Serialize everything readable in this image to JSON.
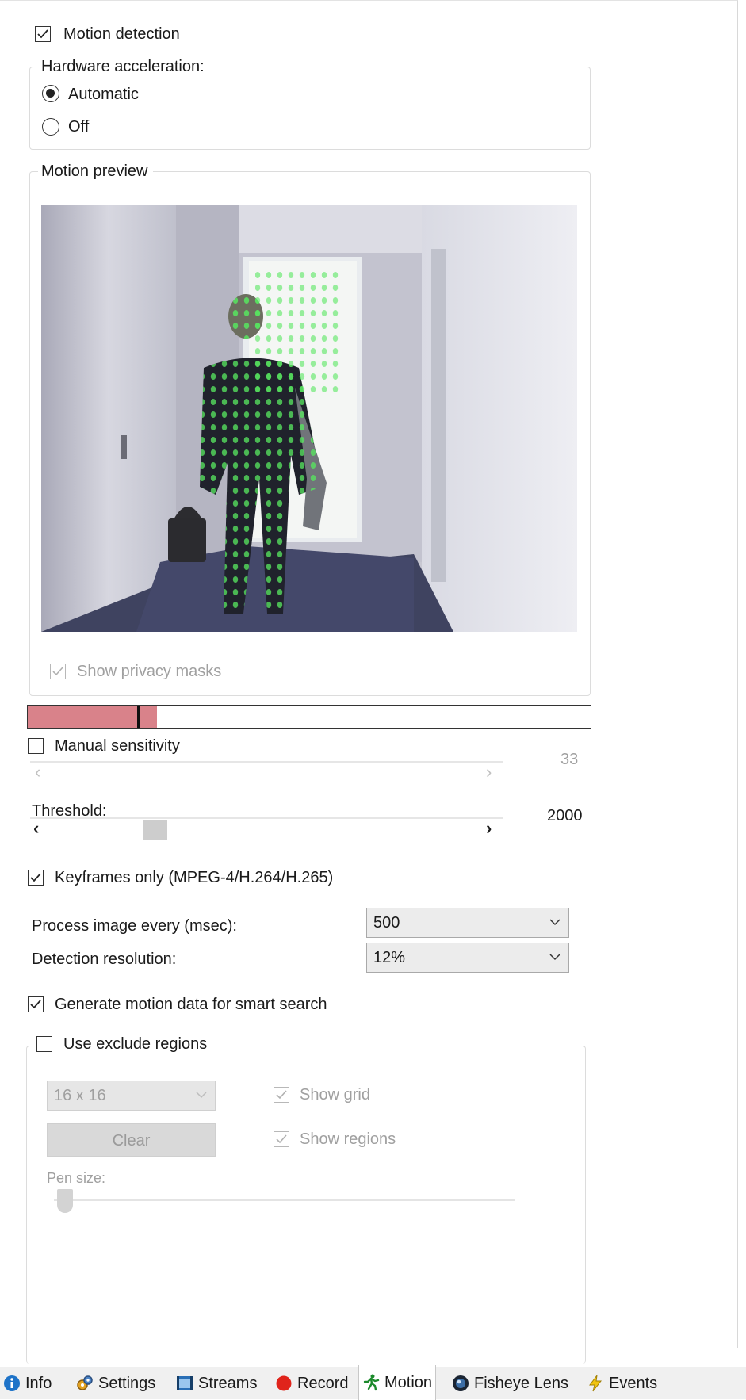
{
  "motion_detection": {
    "label": "Motion detection",
    "checked": true
  },
  "hardware_acceleration": {
    "title": "Hardware acceleration:",
    "options": [
      {
        "label": "Automatic",
        "selected": true
      },
      {
        "label": "Off",
        "selected": false
      }
    ]
  },
  "motion_preview": {
    "title": "Motion preview",
    "show_privacy_masks": {
      "label": "Show privacy masks",
      "checked": true,
      "disabled": true
    }
  },
  "motion_level": {
    "fill_fraction": 0.23,
    "marker_fraction": 0.195,
    "fill_color": "#d9828a"
  },
  "manual_sensitivity": {
    "label": "Manual sensitivity",
    "checked": false,
    "value": "33",
    "slider_fraction": 0.0,
    "disabled": true
  },
  "threshold": {
    "label": "Threshold:",
    "value": "2000",
    "slider_fraction": 0.22
  },
  "keyframes_only": {
    "label": "Keyframes only (MPEG-4/H.264/H.265)",
    "checked": true
  },
  "process_image": {
    "label": "Process image every (msec):",
    "value": "500"
  },
  "detection_resolution": {
    "label": "Detection resolution:",
    "value": "12%"
  },
  "generate_motion_data": {
    "label": "Generate motion data for smart search",
    "checked": true
  },
  "exclude_regions": {
    "label": "Use exclude regions",
    "checked": false,
    "grid_size": "16 x 16",
    "clear_label": "Clear",
    "show_grid": {
      "label": "Show grid",
      "checked": true
    },
    "show_regions": {
      "label": "Show regions",
      "checked": true
    },
    "pen_size_label": "Pen size:"
  },
  "tabs": [
    {
      "label": "Info",
      "icon": "info-icon",
      "active": false
    },
    {
      "label": "Settings",
      "icon": "settings-icon",
      "active": false
    },
    {
      "label": "Streams",
      "icon": "streams-icon",
      "active": false
    },
    {
      "label": "Record",
      "icon": "record-icon",
      "active": false
    },
    {
      "label": "Motion",
      "icon": "motion-icon",
      "active": true
    },
    {
      "label": "Fisheye Lens",
      "icon": "fisheye-lens-icon",
      "active": false
    },
    {
      "label": "Events",
      "icon": "events-icon",
      "active": false
    }
  ]
}
